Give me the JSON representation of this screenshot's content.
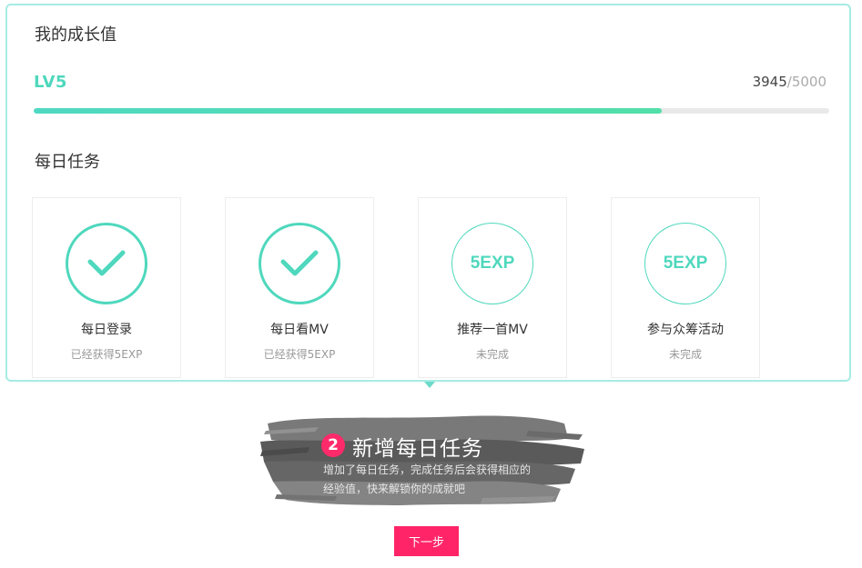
{
  "growth": {
    "title": "我的成长值",
    "level": "LV5",
    "current": "3945",
    "total": "/5000",
    "progress": 0.789
  },
  "daily": {
    "title": "每日任务",
    "tasks": [
      {
        "name": "每日登录",
        "status": "已经获得5EXP",
        "done": true,
        "icon": "checkmark-icon"
      },
      {
        "name": "每日看MV",
        "status": "已经获得5EXP",
        "done": true,
        "icon": "checkmark-icon"
      },
      {
        "name": "推荐一首MV",
        "status": "未完成",
        "done": false,
        "reward": "5EXP"
      },
      {
        "name": "参与众筹活动",
        "status": "未完成",
        "done": false,
        "reward": "5EXP"
      }
    ]
  },
  "guide": {
    "step": "2",
    "title": "新增每日任务",
    "desc_line1": "增加了每日任务，完成任务后会获得相应的",
    "desc_line2": "经验值，快来解锁你的成就吧",
    "next_label": "下一步"
  },
  "colors": {
    "accent": "#4fd8bd",
    "border": "#a6ece3",
    "button": "#ff2468",
    "badge": "#ff2a6a"
  }
}
